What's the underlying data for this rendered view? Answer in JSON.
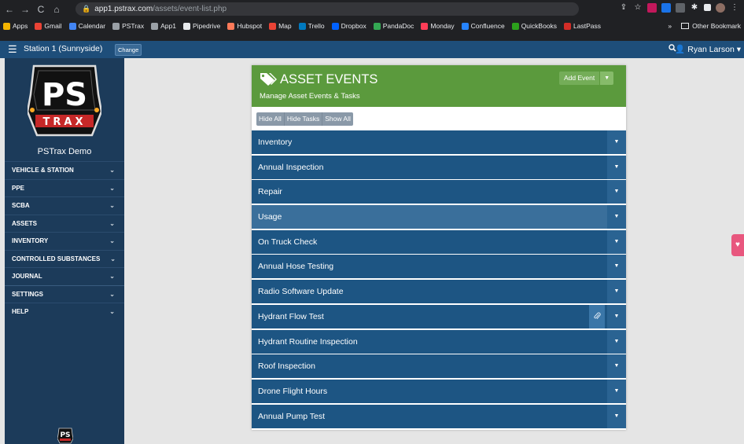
{
  "browser": {
    "url_host": "app1.pstrax.com",
    "url_path": "/assets/event-list.php",
    "nav": {
      "back": "←",
      "forward": "→",
      "reload": "C",
      "home": "⌂"
    },
    "bookmarks": [
      {
        "label": "Apps",
        "color": "#f4b400"
      },
      {
        "label": "Gmail",
        "color": "#ea4335"
      },
      {
        "label": "Calendar",
        "color": "#4285f4"
      },
      {
        "label": "PSTrax",
        "color": "#9aa0a6"
      },
      {
        "label": "App1",
        "color": "#9aa0a6"
      },
      {
        "label": "Pipedrive",
        "color": "#e8eaed"
      },
      {
        "label": "Hubspot",
        "color": "#ff7a59"
      },
      {
        "label": "Map",
        "color": "#ea4335"
      },
      {
        "label": "Trello",
        "color": "#0079bf"
      },
      {
        "label": "Dropbox",
        "color": "#0061ff"
      },
      {
        "label": "PandaDoc",
        "color": "#34a853"
      },
      {
        "label": "Monday",
        "color": "#ff3d57"
      },
      {
        "label": "Confluence",
        "color": "#2684ff"
      },
      {
        "label": "QuickBooks",
        "color": "#2ca01c"
      },
      {
        "label": "LastPass",
        "color": "#d32d27"
      }
    ],
    "bookmarks_more": "»",
    "other_bookmarks": "Other Bookmark"
  },
  "appbar": {
    "menu_icon": "☰",
    "station": "Station 1 (Sunnyside)",
    "change_label": "Change",
    "search_icon": "🔍",
    "user": "Ryan Larson ▾"
  },
  "sidebar": {
    "logo_top": "PS",
    "logo_bottom": "TRAX",
    "org_name": "PSTrax Demo",
    "items": [
      {
        "label": "VEHICLE & STATION"
      },
      {
        "label": "PPE"
      },
      {
        "label": "SCBA"
      },
      {
        "label": "ASSETS"
      },
      {
        "label": "INVENTORY"
      },
      {
        "label": "CONTROLLED SUBSTANCES"
      },
      {
        "label": "JOURNAL"
      },
      {
        "label": "SETTINGS"
      },
      {
        "label": "HELP"
      }
    ],
    "chevron": "⌄",
    "mini_logo": "PS"
  },
  "card": {
    "title": "ASSET EVENTS",
    "subtitle": "Manage Asset Events & Tasks",
    "add_event": "Add Event",
    "add_event_dropdown": "▼",
    "filters": [
      "Hide All",
      "Hide Tasks",
      "Show All"
    ],
    "rows": [
      {
        "label": "Inventory"
      },
      {
        "label": "Annual Inspection"
      },
      {
        "label": "Repair"
      },
      {
        "label": "Usage"
      },
      {
        "label": "On Truck Check"
      },
      {
        "label": "Annual Hose Testing"
      },
      {
        "label": "Radio Software Update"
      },
      {
        "label": "Hydrant Flow Test"
      },
      {
        "label": "Hydrant Routine Inspection"
      },
      {
        "label": "Roof Inspection"
      },
      {
        "label": "Drone Flight Hours"
      },
      {
        "label": "Annual Pump Test"
      }
    ],
    "caret": "▼",
    "clip_icon": "📎"
  },
  "side_tab_icon": "♥"
}
